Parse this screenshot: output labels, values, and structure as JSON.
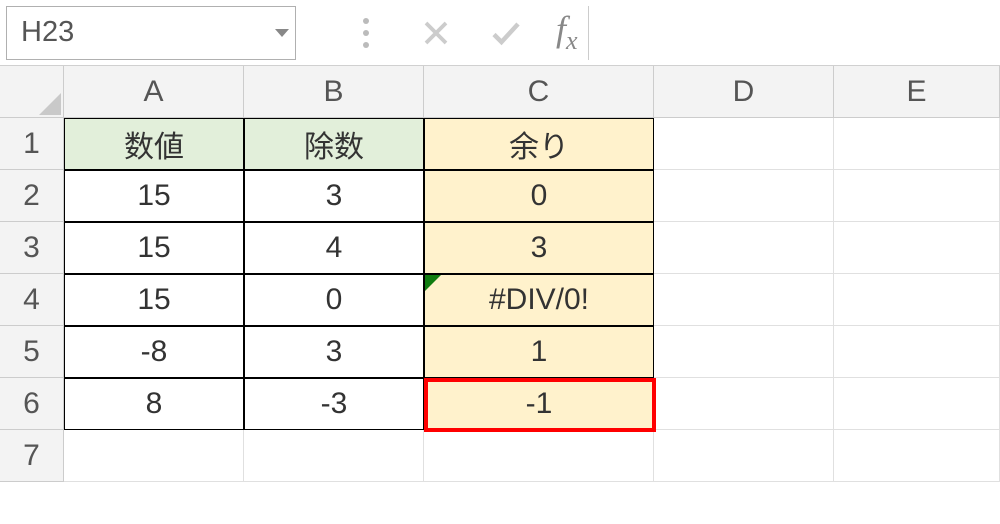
{
  "formula_bar": {
    "name_box_value": "H23",
    "cancel_tooltip": "Cancel",
    "enter_tooltip": "Enter",
    "fx_label": "fx",
    "formula_value": ""
  },
  "columns": [
    "A",
    "B",
    "C",
    "D",
    "E"
  ],
  "rows": [
    "1",
    "2",
    "3",
    "4",
    "5",
    "6",
    "7"
  ],
  "headers": {
    "A": "数値",
    "B": "除数",
    "C": "余り"
  },
  "data": [
    {
      "A": "15",
      "B": "3",
      "C": "0"
    },
    {
      "A": "15",
      "B": "4",
      "C": "3"
    },
    {
      "A": "15",
      "B": "0",
      "C": "#DIV/0!"
    },
    {
      "A": "-8",
      "B": "3",
      "C": "1"
    },
    {
      "A": "8",
      "B": "-3",
      "C": "-1"
    }
  ],
  "highlight": {
    "row": 6,
    "col": "C"
  },
  "chart_data": {
    "type": "table",
    "title": "",
    "columns": [
      "数値",
      "除数",
      "余り"
    ],
    "rows": [
      [
        15,
        3,
        0
      ],
      [
        15,
        4,
        3
      ],
      [
        15,
        0,
        "#DIV/0!"
      ],
      [
        -8,
        3,
        1
      ],
      [
        8,
        -3,
        -1
      ]
    ]
  }
}
